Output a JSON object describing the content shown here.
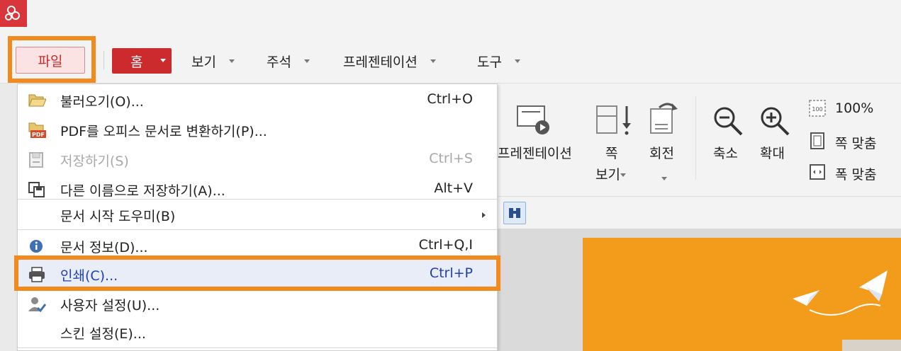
{
  "tabs": {
    "file": "파일",
    "home": "홈",
    "view": "보기",
    "comment": "주석",
    "presentation": "프레젠테이션",
    "tools": "도구"
  },
  "file_menu": {
    "items": [
      {
        "label": "불러오기(O)...",
        "shortcut": "Ctrl+O",
        "icon": "folder-open-icon"
      },
      {
        "label": "PDF를 오피스 문서로 변환하기(P)...",
        "shortcut": "",
        "icon": "pdf-convert-icon"
      },
      {
        "label": "저장하기(S)",
        "shortcut": "Ctrl+S",
        "icon": "save-icon",
        "disabled": true
      },
      {
        "label": "다른 이름으로 저장하기(A)...",
        "shortcut": "Alt+V",
        "icon": "save-as-icon"
      },
      {
        "label": "문서 시작 도우미(B)",
        "shortcut": "",
        "icon": "",
        "submenu": true
      },
      {
        "label": "문서 정보(D)...",
        "shortcut": "Ctrl+Q,I",
        "icon": "info-icon"
      },
      {
        "label": "인쇄(C)...",
        "shortcut": "Ctrl+P",
        "icon": "printer-icon",
        "highlighted": true
      },
      {
        "label": "사용자 설정(U)...",
        "shortcut": "",
        "icon": "user-settings-icon"
      },
      {
        "label": "스킨 설정(E)...",
        "shortcut": "",
        "icon": ""
      }
    ]
  },
  "ribbon": {
    "presentation": "프레젠테이션",
    "page_view_line1": "쪽",
    "page_view_line2": "보기",
    "rotate": "회전",
    "zoom_out": "축소",
    "zoom_in": "확대",
    "actual_size": "100%",
    "fit_page": "쪽 맞춤",
    "fit_width": "폭 맞춤"
  },
  "colors": {
    "accent_red": "#cc2b2e",
    "highlight_orange": "#f28a1d",
    "page_orange": "#f39b1a"
  }
}
